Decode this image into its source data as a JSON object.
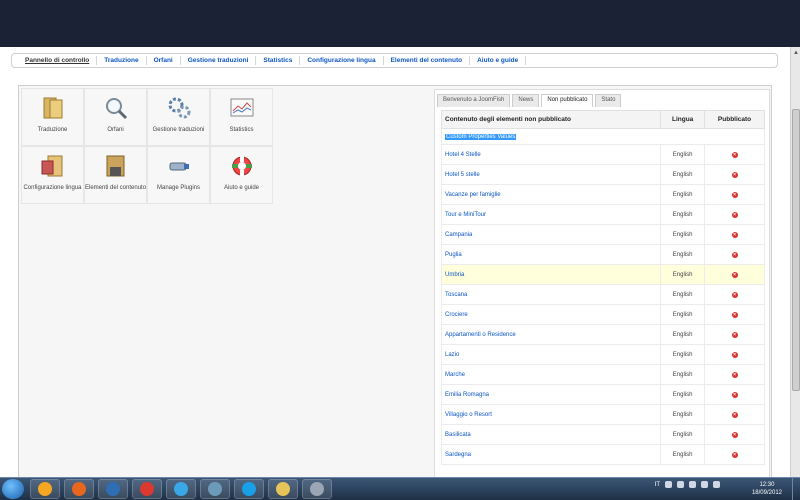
{
  "menu": {
    "items": [
      {
        "label": "Pannello di controllo",
        "active": true
      },
      {
        "label": "Traduzione",
        "active": false
      },
      {
        "label": "Orfani",
        "active": false
      },
      {
        "label": "Gestione traduzioni",
        "active": false
      },
      {
        "label": "Statistics",
        "active": false
      },
      {
        "label": "Configurazione lingua",
        "active": false
      },
      {
        "label": "Elementi del contenuto",
        "active": false
      },
      {
        "label": "Aiuto e guide",
        "active": false
      }
    ]
  },
  "cpanel_icons": [
    {
      "label": "Traduzione",
      "icon": "translation-icon"
    },
    {
      "label": "Orfani",
      "icon": "magnifier-icon"
    },
    {
      "label": "Gestione traduzioni",
      "icon": "gears-icon"
    },
    {
      "label": "Statistics",
      "icon": "statistics-chart-icon"
    },
    {
      "label": "Configurazione lingua",
      "icon": "language-config-icon"
    },
    {
      "label": "Elementi del contenuto",
      "icon": "content-elements-icon"
    },
    {
      "label": "Manage Plugins",
      "icon": "plugin-icon"
    },
    {
      "label": "Aiuto e guide",
      "icon": "help-lifebuoy-icon"
    }
  ],
  "tabs": [
    {
      "label": "Benvenuto a JoomFish",
      "active": false
    },
    {
      "label": "News",
      "active": false
    },
    {
      "label": "Non pubblicato",
      "active": true
    },
    {
      "label": "Stato",
      "active": false
    }
  ],
  "table": {
    "headers": {
      "title": "Contenuto degli elementi non pubblicato",
      "lang": "Lingua",
      "pub": "Pubblicato"
    },
    "selected_row": "Custom Properties Values",
    "rows": [
      {
        "title": "Hotel 4 Stelle",
        "lang": "English",
        "highlight": false
      },
      {
        "title": "Hotel 5 stelle",
        "lang": "English",
        "highlight": false
      },
      {
        "title": "Vacanze per famiglie",
        "lang": "English",
        "highlight": false
      },
      {
        "title": "Tour e MiniTour",
        "lang": "English",
        "highlight": false
      },
      {
        "title": "Campania",
        "lang": "English",
        "highlight": false
      },
      {
        "title": "Puglia",
        "lang": "English",
        "highlight": false
      },
      {
        "title": "Umbria",
        "lang": "English",
        "highlight": true
      },
      {
        "title": "Toscana",
        "lang": "English",
        "highlight": false
      },
      {
        "title": "Crociere",
        "lang": "English",
        "highlight": false
      },
      {
        "title": "Appartamenti o Residence",
        "lang": "English",
        "highlight": false
      },
      {
        "title": "Lazio",
        "lang": "English",
        "highlight": false
      },
      {
        "title": "Marche",
        "lang": "English",
        "highlight": false
      },
      {
        "title": "Emilia Romagna",
        "lang": "English",
        "highlight": false
      },
      {
        "title": "Villaggio o Resort",
        "lang": "English",
        "highlight": false
      },
      {
        "title": "Basilicata",
        "lang": "English",
        "highlight": false
      },
      {
        "title": "Sardegna",
        "lang": "English",
        "highlight": false
      }
    ]
  },
  "taskbar": {
    "lang": "IT",
    "time": "12:30",
    "date": "18/09/2012",
    "apps": [
      "media-player-icon",
      "firefox-icon",
      "thunderbird-icon",
      "chrome-icon",
      "ie-icon",
      "file-manager-icon",
      "skype-icon",
      "folder-icon",
      "calculator-icon"
    ]
  }
}
